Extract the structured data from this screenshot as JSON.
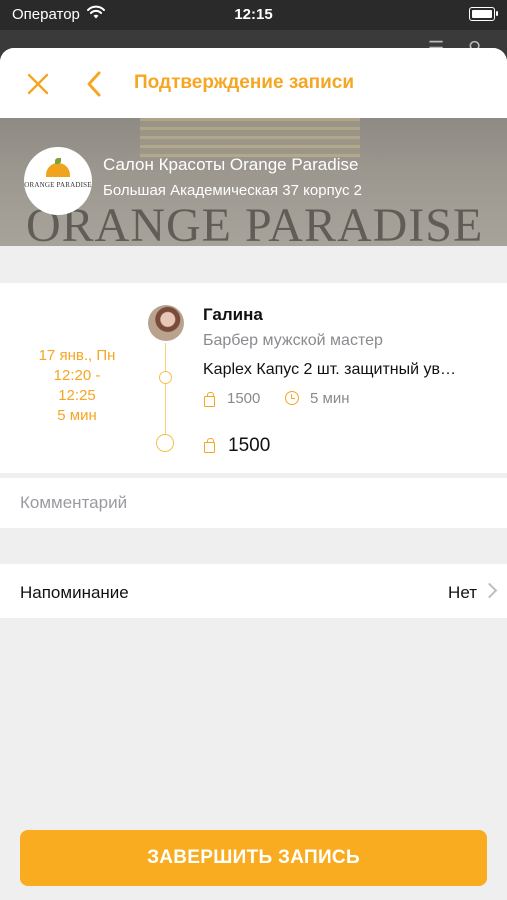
{
  "status_bar": {
    "carrier": "Оператор",
    "time": "12:15"
  },
  "nav": {
    "title": "Подтверждение записи"
  },
  "salon": {
    "name": "Салон Красоты Orange Paradise",
    "address": "Большая Академическая 37 корпус 2",
    "banner_text": "ORANGE PARADISE",
    "logo_text": "ORANGE PARADISE"
  },
  "booking": {
    "date": "17 янв., Пн",
    "time_range_start": "12:20 -",
    "time_range_end": "12:25",
    "duration": "5 мин",
    "master_name": "Галина",
    "master_role": "Барбер мужской мастер",
    "service_name": "Kaplex Капус 2 шт. защитный ув…",
    "service_price": "1500",
    "service_duration": "5 мин",
    "total_price": "1500"
  },
  "comment": {
    "placeholder": "Комментарий"
  },
  "reminder": {
    "label": "Напоминание",
    "value": "Нет"
  },
  "finish_button": {
    "label": "ЗАВЕРШИТЬ ЗАПИСЬ"
  },
  "colors": {
    "accent": "#f5a623",
    "button": "#f9ac1f",
    "background": "#efeff0"
  }
}
